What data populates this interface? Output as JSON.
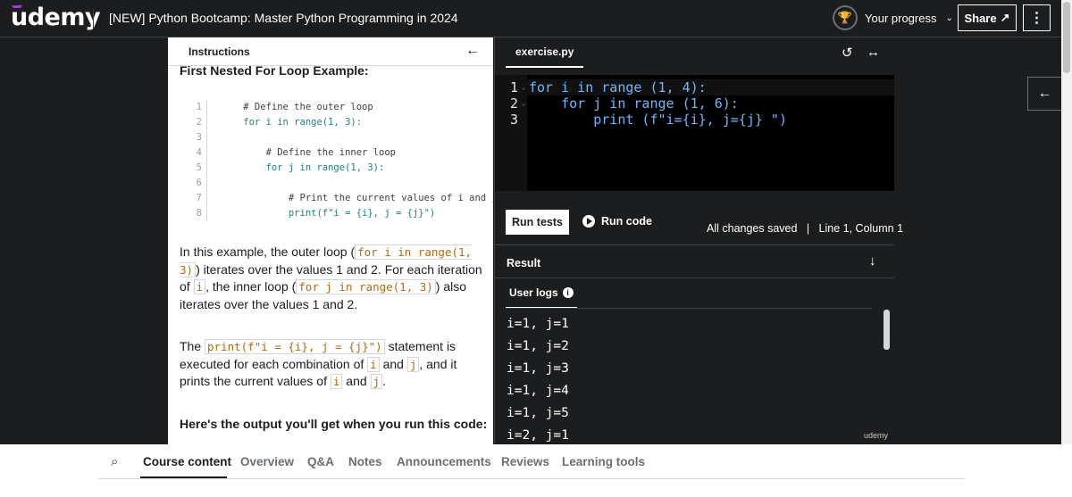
{
  "header": {
    "logo": "udemy",
    "course_title": "[NEW] Python Bootcamp: Master Python Programming in 2024",
    "progress_label": "Your progress",
    "share_label": "Share",
    "more_icon": "kebab-icon",
    "trophy_icon": "trophy-icon"
  },
  "instructions": {
    "title": "Instructions",
    "cut_heading": "First Nested For Loop Example:",
    "code_lines": [
      {
        "n": "1",
        "text": "    # Define the outer loop",
        "kind": "comment"
      },
      {
        "n": "2",
        "text": "    for i in range(1, 3):",
        "kind": "code"
      },
      {
        "n": "3",
        "text": "",
        "kind": "code"
      },
      {
        "n": "4",
        "text": "        # Define the inner loop",
        "kind": "comment"
      },
      {
        "n": "5",
        "text": "        for j in range(1, 3):",
        "kind": "code"
      },
      {
        "n": "6",
        "text": "",
        "kind": "code"
      },
      {
        "n": "7",
        "text": "            # Print the current values of i and j",
        "kind": "comment"
      },
      {
        "n": "8",
        "text": "            print(f\"i = {i}, j = {j}\")",
        "kind": "code"
      }
    ],
    "para1": {
      "t1": "In this example, the outer loop (",
      "c1": "for i in range(1, 3)",
      "t2": ") iterates over the values 1 and 2. For each iteration of",
      "c2": "i",
      "t3": ", the inner loop (",
      "c3": "for j in range(1, 3)",
      "t4": ") also iterates over the values 1 and 2."
    },
    "para2": {
      "t1": "The",
      "c1": "print(f\"i = {i}, j = {j}\")",
      "t2": "statement is executed for each combination of",
      "c2": "i",
      "t3": "and",
      "c3": "j",
      "t4": ", and it prints the current values of",
      "c4": "i",
      "t5": "and",
      "c5": "j",
      "t6": "."
    },
    "output_heading": "Here's the output you'll get when you run this code:"
  },
  "editor": {
    "tab_label": "exercise.py",
    "reset_icon": "reset-icon",
    "expand_icon": "expand-icon",
    "lines": [
      {
        "n": "1",
        "text": "for i in range (1, 4):"
      },
      {
        "n": "2",
        "text": "    for j in range (1, 6):"
      },
      {
        "n": "3",
        "text": "        print (f\"i={i}, j={j} \")"
      }
    ],
    "run_tests_label": "Run tests",
    "run_code_label": "Run code",
    "status_saved": "All changes saved",
    "status_sep": "|",
    "status_position": "Line 1, Column 1",
    "result_label": "Result",
    "user_logs_label": "User logs",
    "logs": [
      "i=1, j=1",
      "i=1, j=2",
      "i=1, j=3",
      "i=1, j=4",
      "i=1, j=5",
      "i=2, j=1"
    ],
    "watermark": "udemy"
  },
  "bottom_tabs": {
    "items": [
      "Course content",
      "Overview",
      "Q&A",
      "Notes",
      "Announcements",
      "Reviews",
      "Learning tools"
    ],
    "active": "Course content"
  },
  "colors": {
    "background": "#1c1d1f",
    "brand_purple": "#a435f0",
    "inline_code": "#b4690e"
  }
}
